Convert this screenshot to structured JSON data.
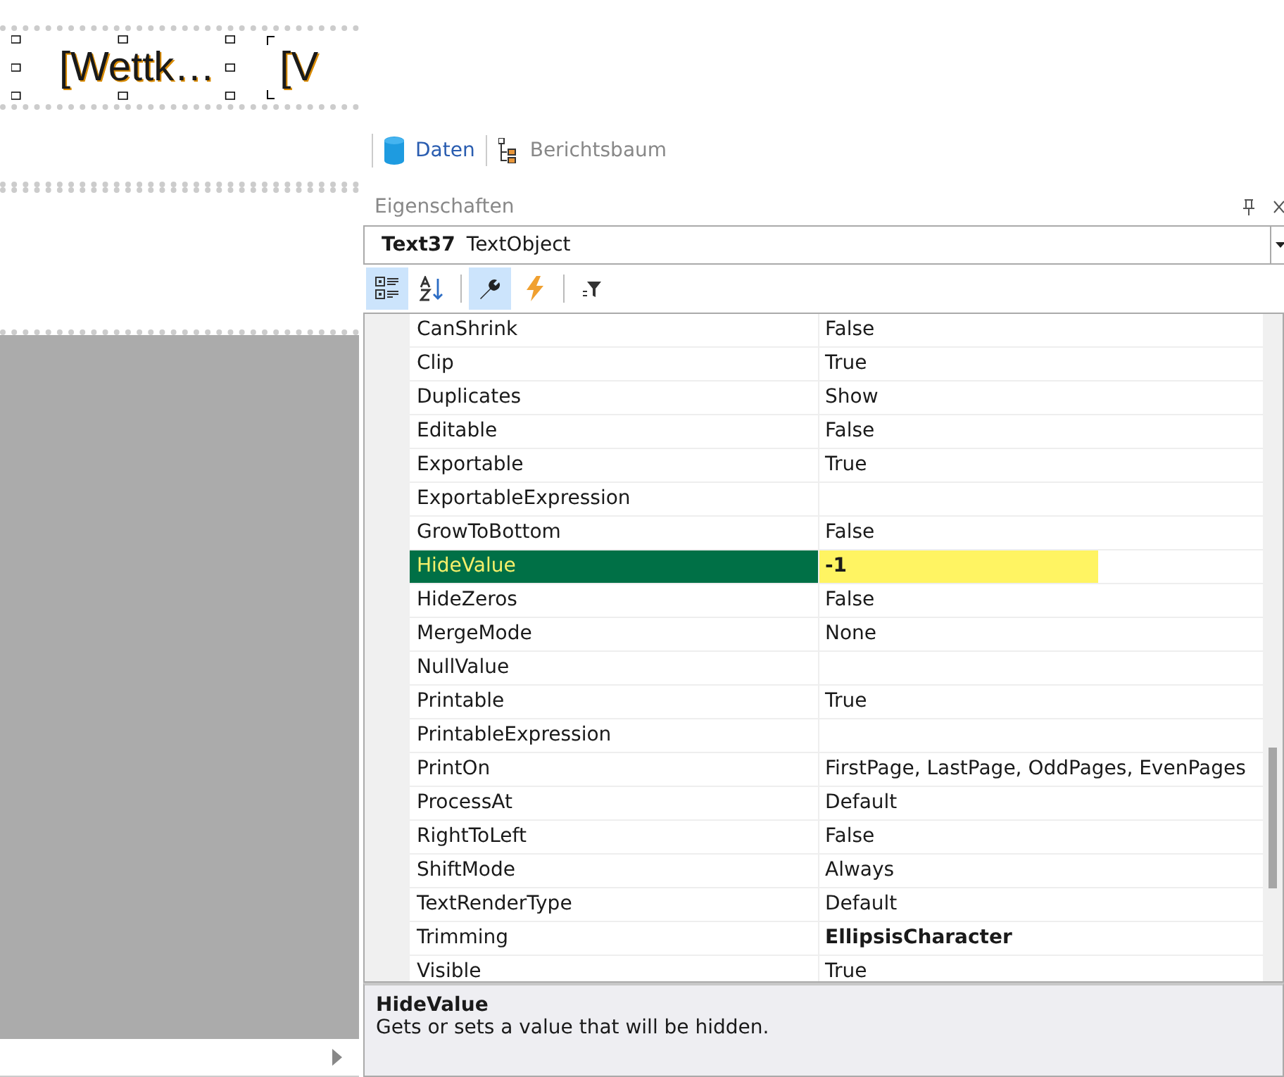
{
  "canvas": {
    "objects": [
      {
        "text": "[Wettk…",
        "selected": true
      },
      {
        "text": "[V",
        "selected": false
      }
    ]
  },
  "panel_tabs": [
    {
      "label": "Daten",
      "selected": true,
      "kind": "data"
    },
    {
      "label": "Berichtsbaum",
      "selected": false,
      "kind": "tree"
    }
  ],
  "properties": {
    "title": "Eigenschaften",
    "object": {
      "name": "Text37",
      "type": "TextObject"
    },
    "toolbar": [
      {
        "kind": "categorized",
        "selected": true
      },
      {
        "kind": "alphabetical",
        "selected": false
      },
      {
        "kind": "properties",
        "selected": true
      },
      {
        "kind": "events",
        "selected": false
      },
      {
        "kind": "filter",
        "selected": false
      }
    ],
    "rows": [
      {
        "name": "CanShrink",
        "value": "False",
        "selected": false,
        "modified": false
      },
      {
        "name": "Clip",
        "value": "True",
        "selected": false,
        "modified": false
      },
      {
        "name": "Duplicates",
        "value": "Show",
        "selected": false,
        "modified": false
      },
      {
        "name": "Editable",
        "value": "False",
        "selected": false,
        "modified": false
      },
      {
        "name": "Exportable",
        "value": "True",
        "selected": false,
        "modified": false
      },
      {
        "name": "ExportableExpression",
        "selected": false
      },
      {
        "name": "GrowToBottom",
        "value": "False",
        "selected": false,
        "modified": false
      },
      {
        "name": "HideValue",
        "value": "-1",
        "selected": true,
        "modified": true
      },
      {
        "name": "HideZeros",
        "value": "False",
        "selected": false,
        "modified": false
      },
      {
        "name": "MergeMode",
        "value": "None",
        "selected": false,
        "modified": false
      },
      {
        "name": "NullValue",
        "selected": false
      },
      {
        "name": "Printable",
        "value": "True",
        "selected": false,
        "modified": false
      },
      {
        "name": "PrintableExpression",
        "selected": false
      },
      {
        "name": "PrintOn",
        "value": "FirstPage, LastPage, OddPages, EvenPages",
        "selected": false,
        "modified": false
      },
      {
        "name": "ProcessAt",
        "value": "Default",
        "selected": false,
        "modified": false
      },
      {
        "name": "RightToLeft",
        "value": "False",
        "selected": false,
        "modified": false
      },
      {
        "name": "ShiftMode",
        "value": "Always",
        "selected": false,
        "modified": false
      },
      {
        "name": "TextRenderType",
        "value": "Default",
        "selected": false,
        "modified": false
      },
      {
        "name": "Trimming",
        "value": "EllipsisCharacter",
        "selected": false,
        "modified": true
      },
      {
        "name": "Visible",
        "value": "True",
        "selected": false,
        "modified": false
      }
    ],
    "description": {
      "title": "HideValue",
      "text": "Gets or sets a value that will be hidden."
    }
  }
}
